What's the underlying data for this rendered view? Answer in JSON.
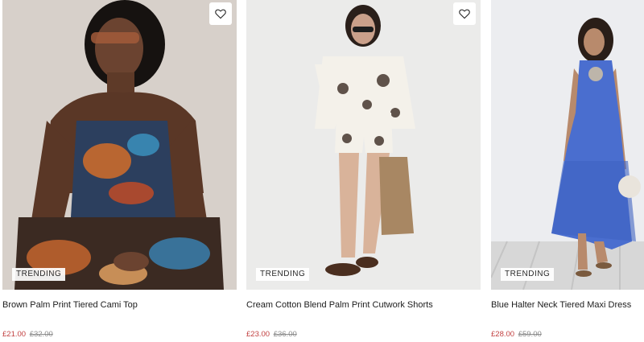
{
  "products": [
    {
      "badge": "TRENDING",
      "name": "Brown Palm Print Tiered Cami Top",
      "sale_price": "£21.00",
      "original_price": "£32.00"
    },
    {
      "badge": "TRENDING",
      "name": "Cream Cotton Blend Palm Print Cutwork Shorts",
      "sale_price": "£23.00",
      "original_price": "£36.00"
    },
    {
      "badge": "TRENDING",
      "name": "Blue Halter Neck Tiered Maxi Dress",
      "sale_price": "£28.00",
      "original_price": "£59.00"
    }
  ],
  "icons": {
    "wishlist": "heart-outline-icon"
  },
  "colors": {
    "sale_price": "#c24141",
    "original_price": "#8a8a8a",
    "text": "#1c1c1c"
  }
}
